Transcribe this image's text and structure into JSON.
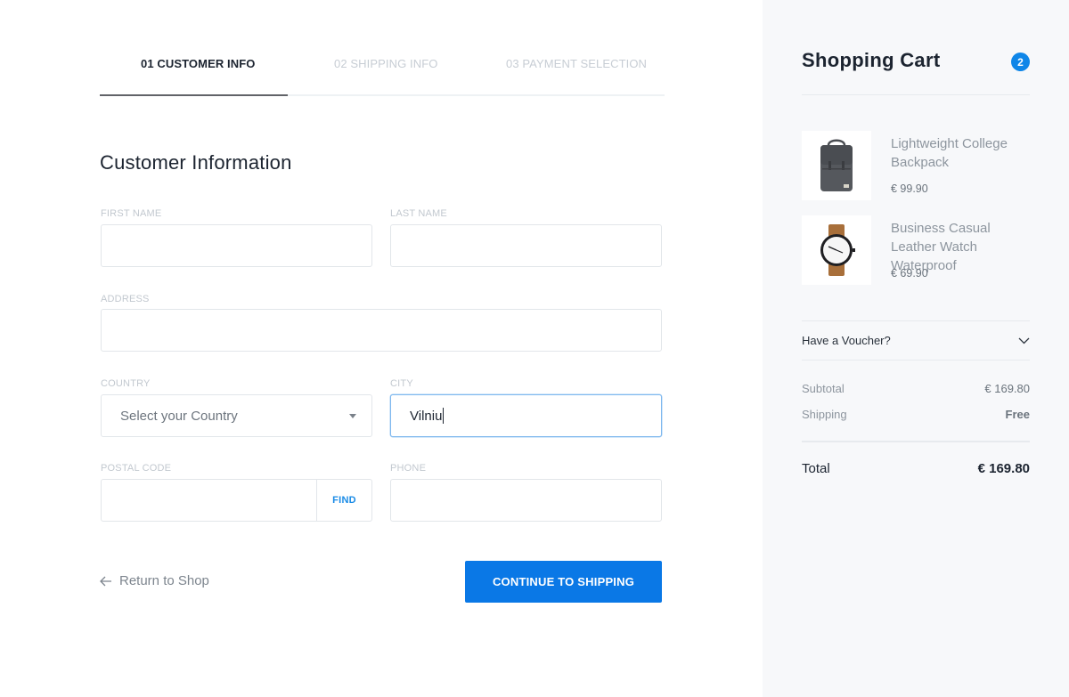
{
  "steps": [
    {
      "label": "01 CUSTOMER INFO",
      "state": "active"
    },
    {
      "label": "02 SHIPPING INFO",
      "state": "inactive"
    },
    {
      "label": "03 PAYMENT SELECTION",
      "state": "inactive"
    }
  ],
  "form": {
    "title": "Customer Information",
    "first_name": {
      "label": "FIRST NAME",
      "value": ""
    },
    "last_name": {
      "label": "LAST NAME",
      "value": ""
    },
    "address": {
      "label": "ADDRESS",
      "value": ""
    },
    "country": {
      "label": "COUNTRY",
      "selected": "Select your Country"
    },
    "city": {
      "label": "CITY",
      "value": "Vilniu"
    },
    "postal_code": {
      "label": "POSTAL CODE",
      "value": "",
      "find_label": "FIND"
    },
    "phone": {
      "label": "PHONE",
      "value": ""
    }
  },
  "actions": {
    "return_label": "Return to Shop",
    "continue_label": "CONTINUE TO SHIPPING"
  },
  "cart": {
    "title": "Shopping Cart",
    "count": "2",
    "items": [
      {
        "name": "Lightweight College Backpack",
        "price": "€ 99.90",
        "icon": "backpack-icon"
      },
      {
        "name": "Business Casual Leather Watch Waterproof",
        "price": "€ 69.90",
        "icon": "watch-icon"
      }
    ],
    "voucher_label": "Have a Voucher?",
    "subtotal_label": "Subtotal",
    "subtotal_value": "€ 169.80",
    "shipping_label": "Shipping",
    "shipping_value": "Free",
    "total_label": "Total",
    "total_value": "€ 169.80"
  },
  "colors": {
    "accent": "#0a78e6",
    "badge": "#0f86e8",
    "sidebar_bg": "#f7f8fa"
  }
}
